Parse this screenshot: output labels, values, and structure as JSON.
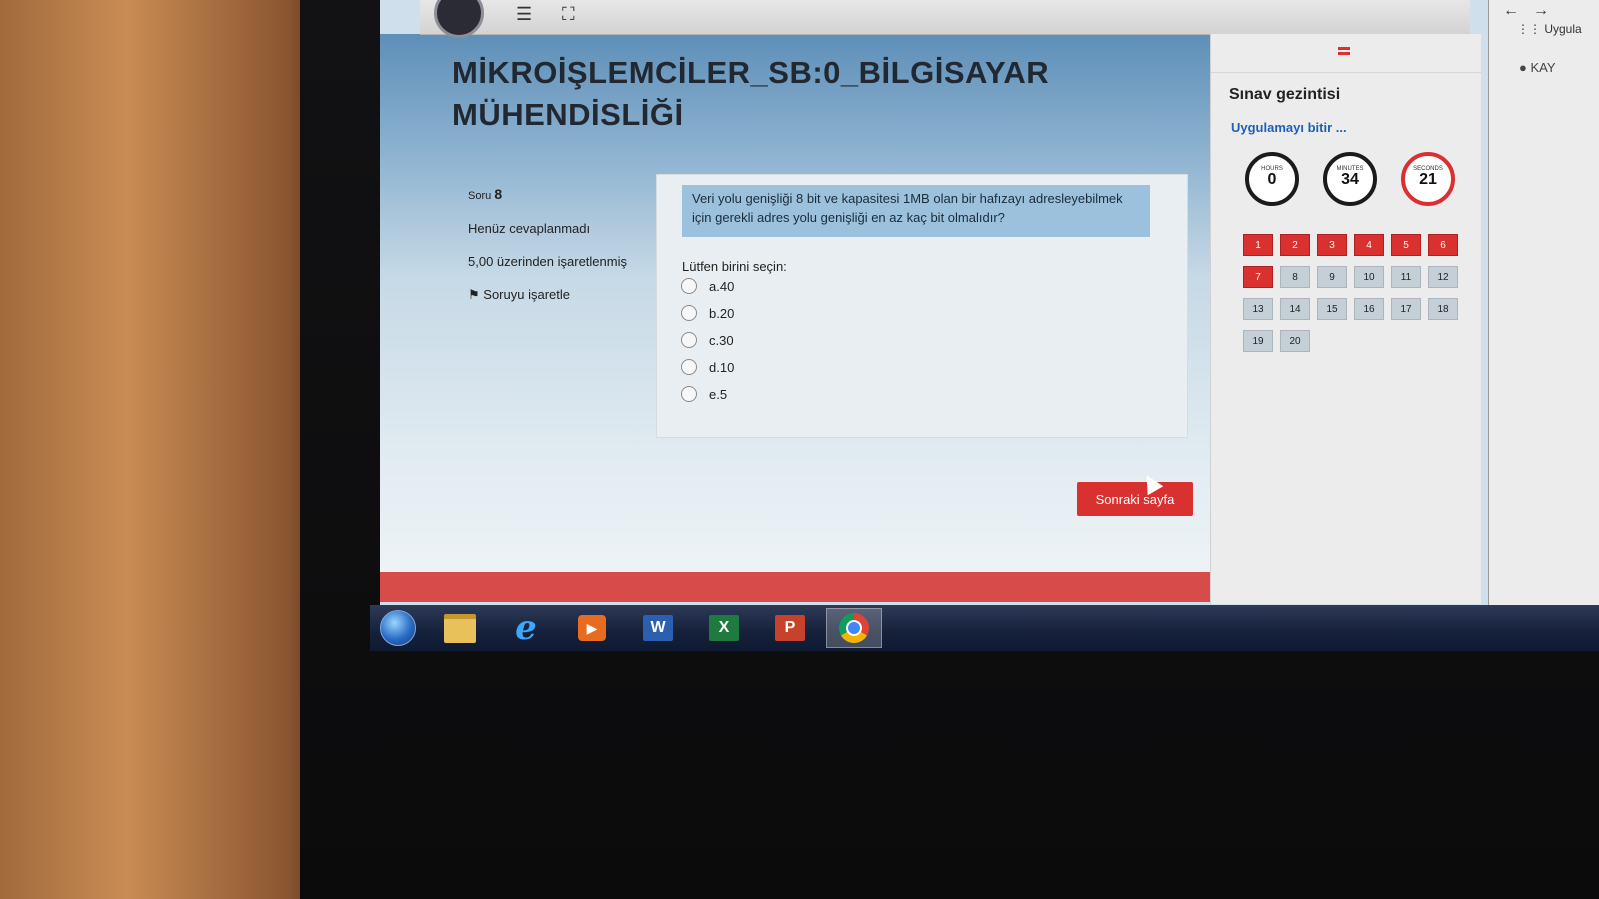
{
  "exam": {
    "title": "MİKROİŞLEMCİLER_SB:0_BİLGİSAYAR MÜHENDİSLİĞİ"
  },
  "question_info": {
    "soru_label": "Soru",
    "number": "8",
    "status": "Henüz cevaplanmadı",
    "marks": "5,00 üzerinden işaretlenmiş",
    "flag_label": "Soruyu işaretle"
  },
  "question": {
    "text": "Veri yolu genişliği 8 bit ve kapasitesi 1MB olan bir hafızayı adresleyebilmek için gerekli adres yolu genişliği en az kaç bit olmalıdır?",
    "prompt": "Lütfen birini seçin:",
    "options": [
      "a.40",
      "b.20",
      "c.30",
      "d.10",
      "e.5"
    ]
  },
  "buttons": {
    "next": "Sonraki sayfa"
  },
  "sidebar": {
    "title": "Sınav gezintisi",
    "finish_link": "Uygulamayı bitir ...",
    "timer": {
      "hours_label": "HOURS",
      "hours": "0",
      "minutes_label": "MINUTES",
      "minutes": "34",
      "seconds_label": "SECONDS",
      "seconds": "21"
    },
    "questions": [
      "1",
      "2",
      "3",
      "4",
      "5",
      "6",
      "7",
      "8",
      "9",
      "10",
      "11",
      "12",
      "13",
      "14",
      "15",
      "16",
      "17",
      "18",
      "19",
      "20"
    ]
  },
  "browser_edge": {
    "apps_label": "Uygula",
    "recording_label": "KAY"
  },
  "colors": {
    "accent_red": "#d9312f",
    "link_blue": "#1f5fb8"
  },
  "taskbar": {
    "icons": [
      "windows-start",
      "file-explorer",
      "internet-explorer",
      "media-player",
      "word",
      "excel",
      "powerpoint",
      "chrome"
    ]
  }
}
